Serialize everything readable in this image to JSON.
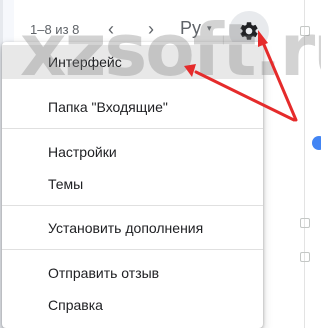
{
  "toolbar": {
    "page_count": "1–8 из 8",
    "prev_icon": "chevron-left-icon",
    "next_icon": "chevron-right-icon",
    "language": "Ру",
    "language_caret": "▾",
    "settings_icon": "gear-icon"
  },
  "menu": {
    "items": [
      {
        "label": "Интерфейс",
        "active": true
      },
      {
        "label": "Папка \"Входящие\""
      },
      {
        "label": "Настройки"
      },
      {
        "label": "Темы"
      },
      {
        "label": "Установить дополнения"
      },
      {
        "label": "Отправить отзыв"
      },
      {
        "label": "Справка"
      }
    ]
  },
  "watermark": {
    "text": "xzsoft.ru"
  },
  "colors": {
    "arrow": "#e52b2b",
    "active_item_bg": "#e8e8e8",
    "settings_btn_bg": "#e8eaed",
    "badge": "#4285f4"
  }
}
